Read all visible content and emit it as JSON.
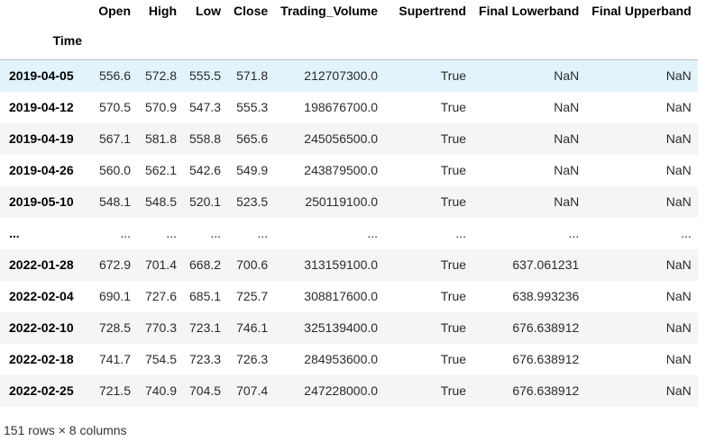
{
  "columns": [
    "Open",
    "High",
    "Low",
    "Close",
    "Trading_Volume",
    "Supertrend",
    "Final Lowerband",
    "Final Upperband"
  ],
  "index_name": "Time",
  "rows": [
    {
      "index": "2019-04-05",
      "cells": [
        "556.6",
        "572.8",
        "555.5",
        "571.8",
        "212707300.0",
        "True",
        "NaN",
        "NaN"
      ]
    },
    {
      "index": "2019-04-12",
      "cells": [
        "570.5",
        "570.9",
        "547.3",
        "555.3",
        "198676700.0",
        "True",
        "NaN",
        "NaN"
      ]
    },
    {
      "index": "2019-04-19",
      "cells": [
        "567.1",
        "581.8",
        "558.8",
        "565.6",
        "245056500.0",
        "True",
        "NaN",
        "NaN"
      ]
    },
    {
      "index": "2019-04-26",
      "cells": [
        "560.0",
        "562.1",
        "542.6",
        "549.9",
        "243879500.0",
        "True",
        "NaN",
        "NaN"
      ]
    },
    {
      "index": "2019-05-10",
      "cells": [
        "548.1",
        "548.5",
        "520.1",
        "523.5",
        "250119100.0",
        "True",
        "NaN",
        "NaN"
      ]
    },
    {
      "index": "...",
      "cells": [
        "...",
        "...",
        "...",
        "...",
        "...",
        "...",
        "...",
        "..."
      ]
    },
    {
      "index": "2022-01-28",
      "cells": [
        "672.9",
        "701.4",
        "668.2",
        "700.6",
        "313159100.0",
        "True",
        "637.061231",
        "NaN"
      ]
    },
    {
      "index": "2022-02-04",
      "cells": [
        "690.1",
        "727.6",
        "685.1",
        "725.7",
        "308817600.0",
        "True",
        "638.993236",
        "NaN"
      ]
    },
    {
      "index": "2022-02-10",
      "cells": [
        "728.5",
        "770.3",
        "723.1",
        "746.1",
        "325139400.0",
        "True",
        "676.638912",
        "NaN"
      ]
    },
    {
      "index": "2022-02-18",
      "cells": [
        "741.7",
        "754.5",
        "723.3",
        "726.3",
        "284953600.0",
        "True",
        "676.638912",
        "NaN"
      ]
    },
    {
      "index": "2022-02-25",
      "cells": [
        "721.5",
        "740.9",
        "704.5",
        "707.4",
        "247228000.0",
        "True",
        "676.638912",
        "NaN"
      ]
    }
  ],
  "footer": "151 rows × 8 columns"
}
